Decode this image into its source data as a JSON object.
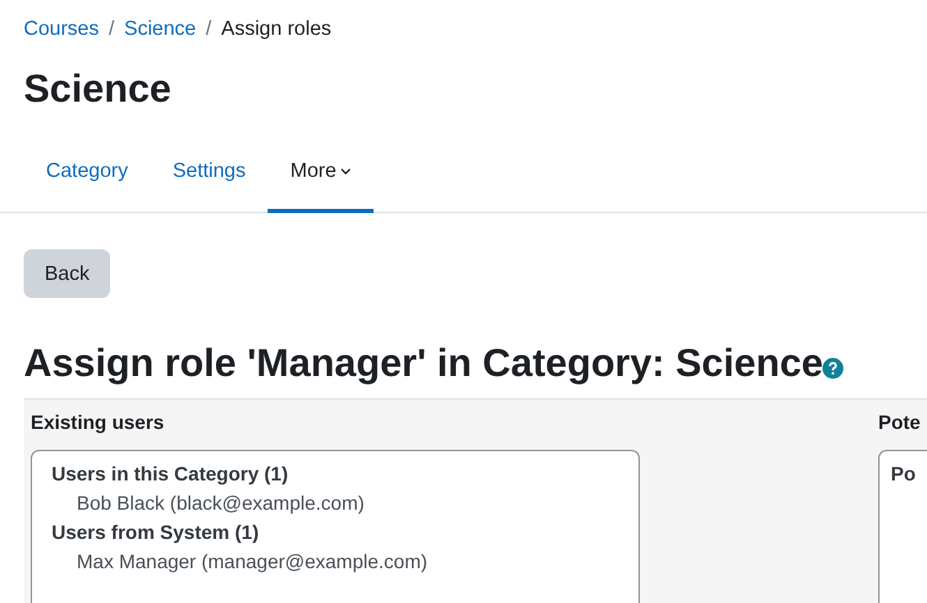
{
  "breadcrumb": [
    {
      "kind": "link",
      "label": "Courses"
    },
    {
      "kind": "separator",
      "label": "/"
    },
    {
      "kind": "link",
      "label": "Science"
    },
    {
      "kind": "separator",
      "label": "/"
    },
    {
      "kind": "current",
      "label": "Assign roles"
    }
  ],
  "page_title": "Science",
  "tabs": [
    {
      "label": "Category",
      "selected": false,
      "dropdown": false
    },
    {
      "label": "Settings",
      "selected": false,
      "dropdown": false
    },
    {
      "label": "More",
      "selected": true,
      "dropdown": true
    }
  ],
  "back_button": "Back",
  "heading": "Assign role 'Manager' in Category: Science",
  "existing_users": {
    "title": "Existing users",
    "groups": [
      {
        "label": "Users in this Category (1)",
        "users": [
          "Bob Black (black@example.com)"
        ]
      },
      {
        "label": "Users from System (1)",
        "users": [
          "Max Manager (manager@example.com)"
        ]
      }
    ]
  },
  "potential_users": {
    "title": "Pote",
    "groups": [
      {
        "label": "Po"
      }
    ]
  }
}
